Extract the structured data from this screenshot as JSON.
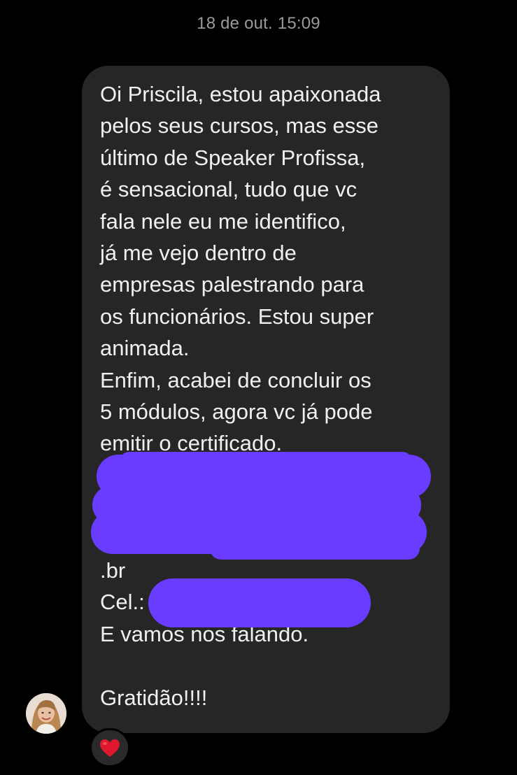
{
  "header": {
    "timestamp": "18 de out. 15:09"
  },
  "message": {
    "lines_before_redaction": [
      "Oi Priscila, estou apaixonada",
      "pelos seus cursos, mas esse",
      "último de Speaker Profissa,",
      "é sensacional, tudo que vc",
      "fala nele eu me identifico,",
      "já me vejo dentro de",
      "empresas palestrando para",
      "os funcionários. Estou super",
      "animada.",
      "Enfim, acabei de concluir os",
      "5 módulos, agora vc já pode",
      "emitir o certificado."
    ],
    "domain_suffix": ".br",
    "phone_label": "Cel.:",
    "closing_line": "E vamos nos falando.",
    "signoff": "Gratidão!!!!"
  },
  "colors": {
    "background": "#000000",
    "bubble": "#262626",
    "text": "#f0f0f0",
    "timestamp": "#9a9a9a",
    "redaction": "#6a3cff",
    "heart": "#e0182d"
  },
  "icons": {
    "avatar": "user-avatar-photo",
    "reaction": "red-heart-icon"
  }
}
